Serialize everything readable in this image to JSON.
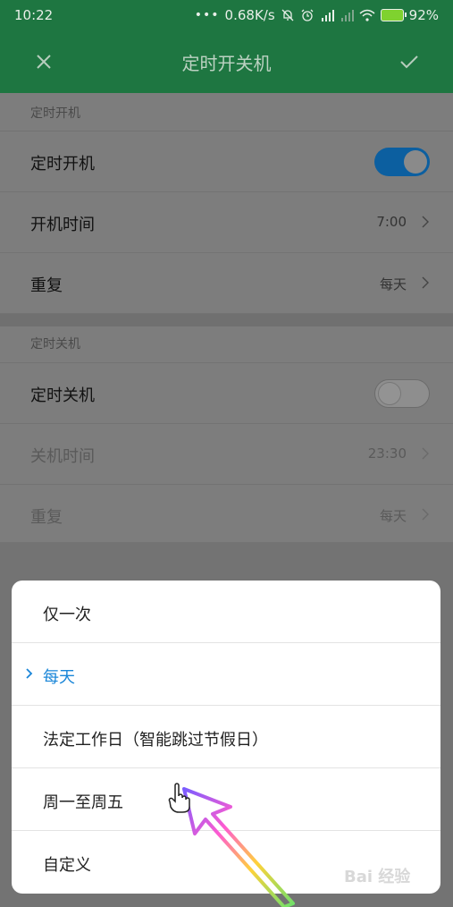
{
  "status_bar": {
    "time": "10:22",
    "network_speed": "0.68K/s",
    "battery": "92%",
    "icons": [
      "more-dots-icon",
      "mute-bell-icon",
      "alarm-icon",
      "signal-icon",
      "signal-weak-icon",
      "wifi-icon",
      "battery-charging-icon"
    ]
  },
  "header": {
    "title": "定时开关机",
    "close_icon": "close-icon",
    "confirm_icon": "check-icon",
    "color": "#1e7641"
  },
  "power_on": {
    "section_title": "定时开机",
    "toggle_label": "定时开机",
    "toggle_on": true,
    "time_label": "开机时间",
    "time_value": "7:00",
    "repeat_label": "重复",
    "repeat_value": "每天"
  },
  "power_off": {
    "section_title": "定时关机",
    "toggle_label": "定时关机",
    "toggle_on": false,
    "time_label": "关机时间",
    "time_value": "23:30",
    "repeat_label": "重复",
    "repeat_value": "每天"
  },
  "repeat_sheet": {
    "options": [
      {
        "label": "仅一次",
        "selected": false
      },
      {
        "label": "每天",
        "selected": true
      },
      {
        "label": "法定工作日（智能跳过节假日）",
        "selected": false
      },
      {
        "label": "周一至周五",
        "selected": false
      },
      {
        "label": "自定义",
        "selected": false
      }
    ],
    "accent": "#1a86d8"
  },
  "watermark": "Bai 经验"
}
